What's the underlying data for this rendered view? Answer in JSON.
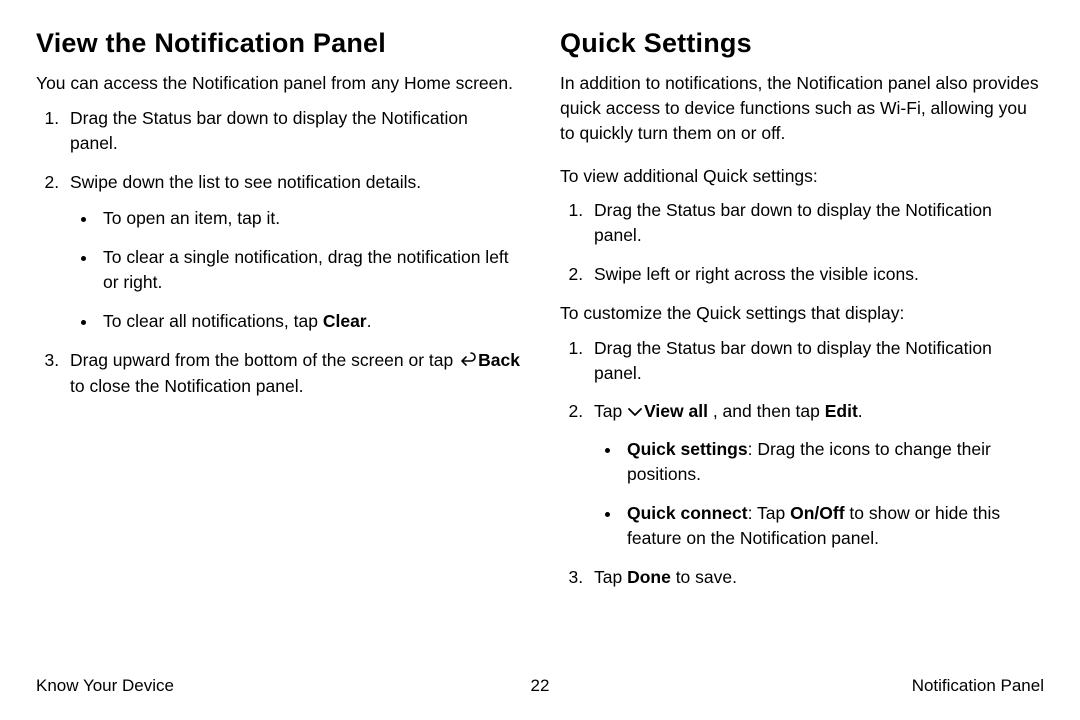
{
  "left": {
    "heading": "View the Notification Panel",
    "intro": "You can access the Notification panel from any Home screen.",
    "step1": "Drag the Status bar down to display the Notification panel.",
    "step2": "Swipe down the list to see notification details.",
    "step2_b1": "To open an item, tap it.",
    "step2_b2": "To clear a single notification, drag the notification left or right.",
    "step2_b3_pre": "To clear all notifications, tap ",
    "step2_b3_bold": "Clear",
    "step2_b3_post": ".",
    "step3_pre": "Drag upward from the bottom of the screen or tap ",
    "step3_bold": "Back",
    "step3_post": " to close the Notification panel."
  },
  "right": {
    "heading": "Quick Settings",
    "intro": "In addition to notifications, the Notification panel also provides quick access to device functions such as Wi-Fi, allowing you to quickly turn them on or off.",
    "view_intro": "To view additional Quick settings:",
    "view_step1": "Drag the Status bar down to display the Notification panel.",
    "view_step2": "Swipe left or right across the visible icons.",
    "cust_intro": "To customize the Quick settings that display:",
    "cust_step1": "Drag the Status bar down to display the Notification panel.",
    "cust_step2_pre": "Tap ",
    "cust_step2_bold1": "View all",
    "cust_step2_mid": " , and then tap ",
    "cust_step2_bold2": "Edit",
    "cust_step2_post": ".",
    "cust_b1_bold": "Quick settings",
    "cust_b1_rest": ": Drag the icons to change their positions.",
    "cust_b2_bold": "Quick connect",
    "cust_b2_mid": ": Tap ",
    "cust_b2_bold2": "On/Off",
    "cust_b2_rest": " to show or hide this feature on the Notification panel.",
    "cust_step3_pre": "Tap ",
    "cust_step3_bold": "Done",
    "cust_step3_post": " to save."
  },
  "footer": {
    "left": "Know Your Device",
    "center": "22",
    "right": "Notification Panel"
  }
}
